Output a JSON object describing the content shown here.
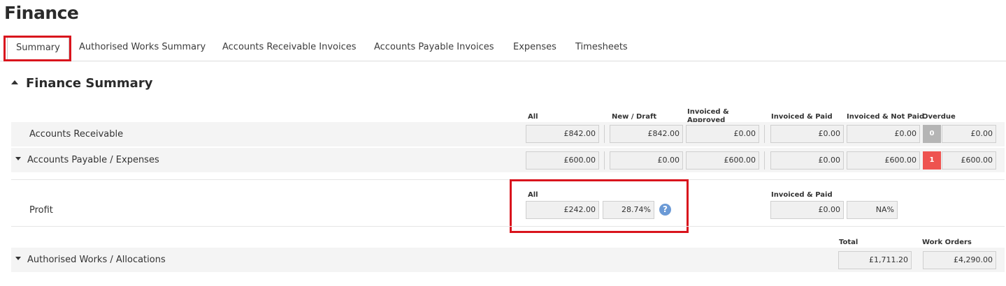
{
  "page": {
    "title": "Finance"
  },
  "tabs": [
    {
      "label": "Summary",
      "active": true
    },
    {
      "label": "Authorised Works Summary"
    },
    {
      "label": "Accounts Receivable Invoices"
    },
    {
      "label": "Accounts Payable Invoices"
    },
    {
      "label": "Expenses"
    },
    {
      "label": "Timesheets"
    }
  ],
  "section": {
    "title": "Finance Summary"
  },
  "summary_columns": {
    "all": "All",
    "new_draft": "New / Draft",
    "invoiced_approved": "Invoiced & Approved",
    "invoiced_paid": "Invoiced & Paid",
    "invoiced_not_paid": "Invoiced & Not Paid",
    "overdue": "Overdue"
  },
  "accounts_receivable": {
    "label": "Accounts Receivable",
    "all": "£842.00",
    "new_draft": "£842.00",
    "invoiced_approved": "£0.00",
    "invoiced_paid": "£0.00",
    "invoiced_not_paid": "£0.00",
    "overdue_count": "0",
    "overdue": "£0.00"
  },
  "accounts_payable": {
    "label": "Accounts Payable / Expenses",
    "all": "£600.00",
    "new_draft": "£0.00",
    "invoiced_approved": "£600.00",
    "invoiced_paid": "£0.00",
    "invoiced_not_paid": "£600.00",
    "overdue_count": "1",
    "overdue": "£600.00"
  },
  "profit": {
    "label": "Profit",
    "all_header": "All",
    "all": "£242.00",
    "all_percent": "28.74%",
    "help_icon": "?",
    "invoiced_paid_header": "Invoiced & Paid",
    "invoiced_paid": "£0.00",
    "invoiced_paid_percent": "NA%"
  },
  "authorised_works": {
    "label": "Authorised Works / Allocations",
    "total_header": "Total",
    "total": "£1,711.20",
    "work_orders_header": "Work Orders",
    "work_orders": "£4,290.00"
  },
  "colors": {
    "highlight": "#d9141d",
    "overdue_zero": "#b5b5b5",
    "overdue_alert": "#ee5350",
    "help_icon": "#6b9ad6"
  }
}
